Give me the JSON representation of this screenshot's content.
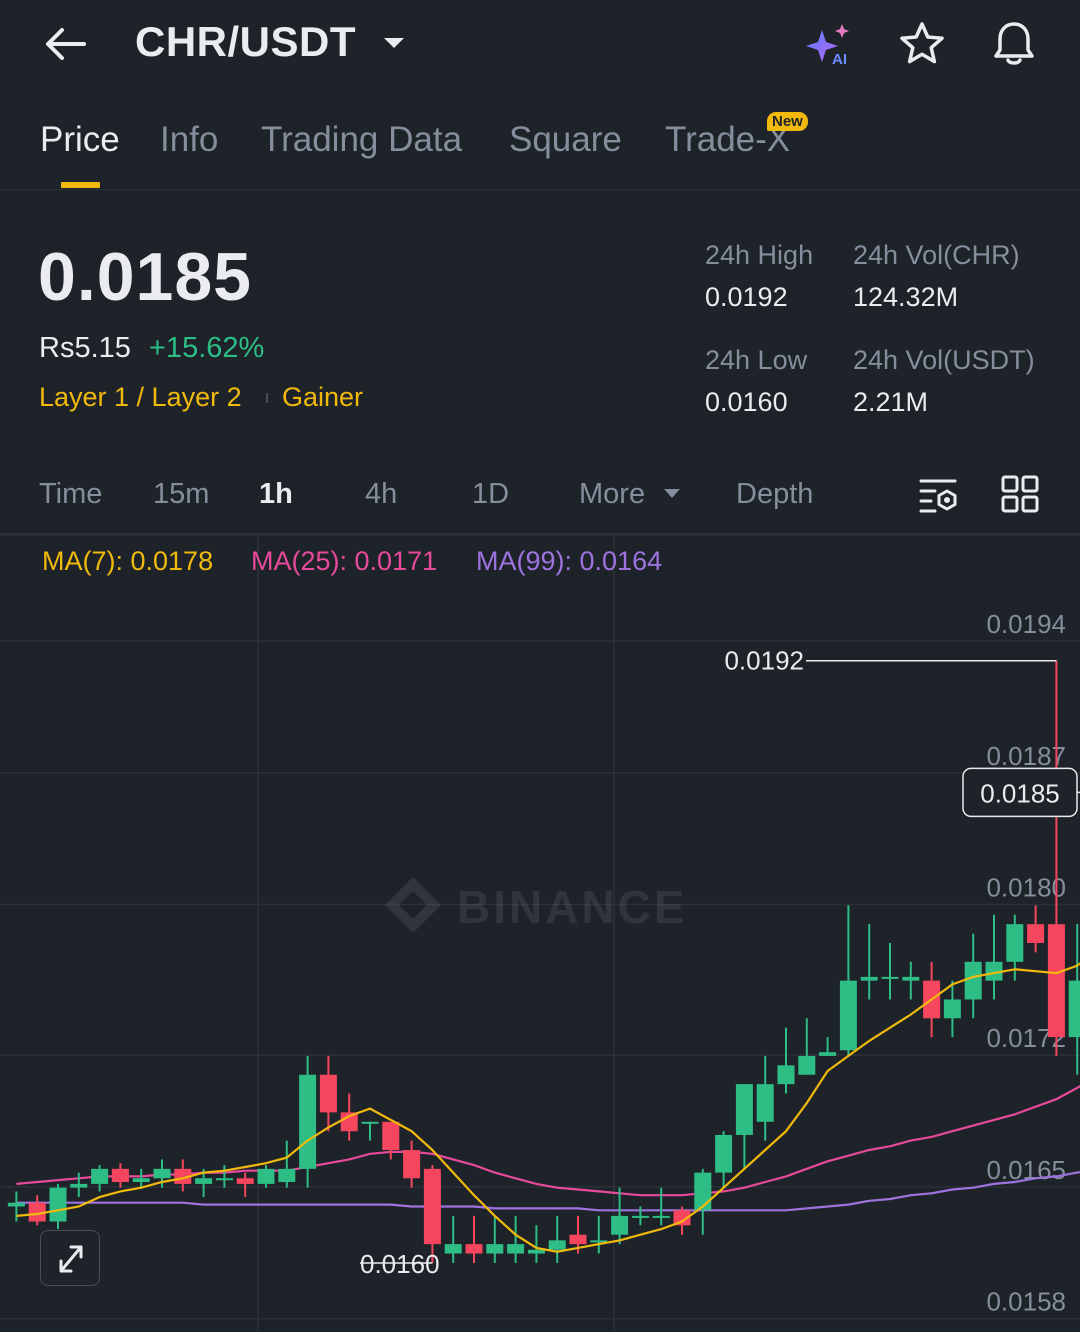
{
  "header": {
    "pair": "CHR/USDT",
    "icons": [
      "back-arrow-icon",
      "caret-down-icon",
      "ai-sparkle-icon",
      "star-icon",
      "bell-icon"
    ],
    "ai_label": "AI"
  },
  "tabs": [
    {
      "label": "Price",
      "active": true
    },
    {
      "label": "Info",
      "active": false
    },
    {
      "label": "Trading Data",
      "active": false
    },
    {
      "label": "Square",
      "active": false
    },
    {
      "label": "Trade-X",
      "active": false
    }
  ],
  "new_badge": "New",
  "ticker": {
    "price": "0.0185",
    "local_price": "Rs5.15",
    "change_pct": "+15.62%",
    "tag1": "Layer 1 / Layer 2",
    "tag2": "Gainer"
  },
  "stats": {
    "high_label": "24h High",
    "high": "0.0192",
    "vol_base_label": "24h Vol(CHR)",
    "vol_base": "124.32M",
    "low_label": "24h Low",
    "low": "0.0160",
    "vol_quote_label": "24h Vol(USDT)",
    "vol_quote": "2.21M"
  },
  "intervals": [
    {
      "label": "Time",
      "active": false
    },
    {
      "label": "15m",
      "active": false
    },
    {
      "label": "1h",
      "active": true
    },
    {
      "label": "4h",
      "active": false
    },
    {
      "label": "1D",
      "active": false
    },
    {
      "label": "More",
      "active": false
    },
    {
      "label": "Depth",
      "active": false
    }
  ],
  "ma": {
    "ma7": "MA(7): 0.0178",
    "ma25": "MA(25): 0.0171",
    "ma99": "MA(99): 0.0164"
  },
  "colors": {
    "up": "#2ebd85",
    "down": "#f6465d",
    "accent": "#f0b90b",
    "ma7": "#f0b90b",
    "ma25": "#e84a9b",
    "ma99": "#9e73e0"
  },
  "watermark": "BINANCE",
  "chart_data": {
    "type": "candlestick",
    "interval": "1h",
    "y_ticks": [
      "0.0194",
      "0.0187",
      "0.0180",
      "0.0172",
      "0.0165",
      "0.0158"
    ],
    "y_tick_values": [
      0.0194,
      0.0187,
      0.018,
      0.0172,
      0.0165,
      0.0158
    ],
    "ylim": [
      0.01575,
      0.01965
    ],
    "current_price": "0.0185",
    "max_label": "0.0192",
    "min_label": "0.0160",
    "candles": [
      [
        0.0163,
        0.01632,
        0.01622,
        0.01638
      ],
      [
        0.01632,
        0.01622,
        0.0162,
        0.01636
      ],
      [
        0.01622,
        0.0164,
        0.01618,
        0.01642
      ],
      [
        0.0164,
        0.01642,
        0.01635,
        0.01648
      ],
      [
        0.01642,
        0.0165,
        0.01638,
        0.01652
      ],
      [
        0.0165,
        0.01643,
        0.0164,
        0.01653
      ],
      [
        0.01643,
        0.01645,
        0.0164,
        0.0165
      ],
      [
        0.01645,
        0.0165,
        0.0164,
        0.01655
      ],
      [
        0.0165,
        0.01642,
        0.01638,
        0.01655
      ],
      [
        0.01642,
        0.01645,
        0.01635,
        0.0165
      ],
      [
        0.01645,
        0.01645,
        0.0164,
        0.01652
      ],
      [
        0.01645,
        0.01642,
        0.01635,
        0.01648
      ],
      [
        0.01642,
        0.0165,
        0.0164,
        0.01652
      ],
      [
        0.01643,
        0.0165,
        0.0164,
        0.01665
      ],
      [
        0.0165,
        0.017,
        0.0164,
        0.0171
      ],
      [
        0.017,
        0.0168,
        0.0167,
        0.0171
      ],
      [
        0.0168,
        0.0167,
        0.01665,
        0.0169
      ],
      [
        0.01675,
        0.01675,
        0.01665,
        0.01675
      ],
      [
        0.01675,
        0.0166,
        0.01655,
        0.0167
      ],
      [
        0.0166,
        0.01645,
        0.0164,
        0.01665
      ],
      [
        0.0165,
        0.0161,
        0.016,
        0.01652
      ],
      [
        0.01605,
        0.0161,
        0.016,
        0.01625
      ],
      [
        0.0161,
        0.01605,
        0.016,
        0.01625
      ],
      [
        0.01605,
        0.0161,
        0.016,
        0.01625
      ],
      [
        0.01605,
        0.0161,
        0.016,
        0.01625
      ],
      [
        0.01605,
        0.01607,
        0.016,
        0.0162
      ],
      [
        0.01607,
        0.01612,
        0.016,
        0.01625
      ],
      [
        0.01615,
        0.0161,
        0.01605,
        0.01625
      ],
      [
        0.01612,
        0.01612,
        0.01605,
        0.01625
      ],
      [
        0.01615,
        0.01625,
        0.0161,
        0.0164
      ],
      [
        0.01625,
        0.01625,
        0.0162,
        0.0163
      ],
      [
        0.01625,
        0.01625,
        0.0162,
        0.0164
      ],
      [
        0.01628,
        0.0162,
        0.01615,
        0.0163
      ],
      [
        0.01628,
        0.01648,
        0.01615,
        0.0165
      ],
      [
        0.01648,
        0.01668,
        0.0164,
        0.0167
      ],
      [
        0.01668,
        0.01695,
        0.0165,
        0.01695
      ],
      [
        0.01675,
        0.01695,
        0.01665,
        0.0171
      ],
      [
        0.01695,
        0.01705,
        0.0169,
        0.01725
      ],
      [
        0.017,
        0.0171,
        0.017,
        0.0173
      ],
      [
        0.0171,
        0.01712,
        0.0171,
        0.0172
      ],
      [
        0.01713,
        0.0175,
        0.0171,
        0.0179
      ],
      [
        0.0175,
        0.01752,
        0.0174,
        0.0178
      ],
      [
        0.01752,
        0.01752,
        0.0174,
        0.0177
      ],
      [
        0.0175,
        0.01752,
        0.0174,
        0.0176
      ],
      [
        0.0175,
        0.0173,
        0.0172,
        0.0176
      ],
      [
        0.0173,
        0.0174,
        0.0172,
        0.0175
      ],
      [
        0.0174,
        0.0176,
        0.0173,
        0.01775
      ],
      [
        0.0175,
        0.0176,
        0.0174,
        0.01785
      ],
      [
        0.0176,
        0.0178,
        0.0175,
        0.01785
      ],
      [
        0.0178,
        0.0177,
        0.01765,
        0.0179
      ],
      [
        0.0178,
        0.0172,
        0.0171,
        0.0192
      ],
      [
        0.0172,
        0.0175,
        0.017,
        0.0178
      ],
      [
        0.0176,
        0.0185,
        0.0173,
        0.0188
      ]
    ],
    "ma7": [
      0.01625,
      0.01626,
      0.01628,
      0.0163,
      0.01635,
      0.01638,
      0.0164,
      0.01643,
      0.01645,
      0.01648,
      0.01649,
      0.01651,
      0.01653,
      0.01656,
      0.01665,
      0.01672,
      0.01678,
      0.01682,
      0.01676,
      0.0167,
      0.0166,
      0.01648,
      0.01636,
      0.01625,
      0.01615,
      0.01608,
      0.01606,
      0.01608,
      0.0161,
      0.01612,
      0.01615,
      0.01618,
      0.01622,
      0.0163,
      0.0164,
      0.0165,
      0.0166,
      0.0167,
      0.01685,
      0.01702,
      0.0171,
      0.01718,
      0.01725,
      0.01732,
      0.0174,
      0.01748,
      0.01752,
      0.01754,
      0.01756,
      0.01755,
      0.01754,
      0.01758,
      0.01766
    ],
    "ma25": [
      0.01642,
      0.01643,
      0.01644,
      0.01645,
      0.01646,
      0.01646,
      0.01646,
      0.01647,
      0.01647,
      0.01648,
      0.01648,
      0.01649,
      0.01649,
      0.01649,
      0.01651,
      0.01653,
      0.01655,
      0.01658,
      0.01659,
      0.01659,
      0.01658,
      0.01655,
      0.01652,
      0.01648,
      0.01645,
      0.01642,
      0.0164,
      0.01639,
      0.01638,
      0.01637,
      0.01636,
      0.01636,
      0.01636,
      0.01637,
      0.01638,
      0.0164,
      0.01643,
      0.01646,
      0.0165,
      0.01654,
      0.01657,
      0.0166,
      0.01662,
      0.01665,
      0.01667,
      0.0167,
      0.01673,
      0.01676,
      0.01679,
      0.01683,
      0.01687,
      0.01693,
      0.017
    ],
    "ma99": [
      0.01632,
      0.01632,
      0.01632,
      0.01632,
      0.01632,
      0.01632,
      0.01632,
      0.01632,
      0.01632,
      0.01631,
      0.01631,
      0.01631,
      0.01631,
      0.01631,
      0.01631,
      0.01631,
      0.01631,
      0.01631,
      0.01631,
      0.0163,
      0.0163,
      0.0163,
      0.0163,
      0.01629,
      0.01629,
      0.01629,
      0.01629,
      0.01629,
      0.01628,
      0.01628,
      0.01628,
      0.01628,
      0.01628,
      0.01628,
      0.01628,
      0.01628,
      0.01628,
      0.01628,
      0.01629,
      0.0163,
      0.01631,
      0.01633,
      0.01634,
      0.01636,
      0.01637,
      0.01639,
      0.0164,
      0.01642,
      0.01643,
      0.01645,
      0.01646,
      0.01648,
      0.0165
    ]
  }
}
